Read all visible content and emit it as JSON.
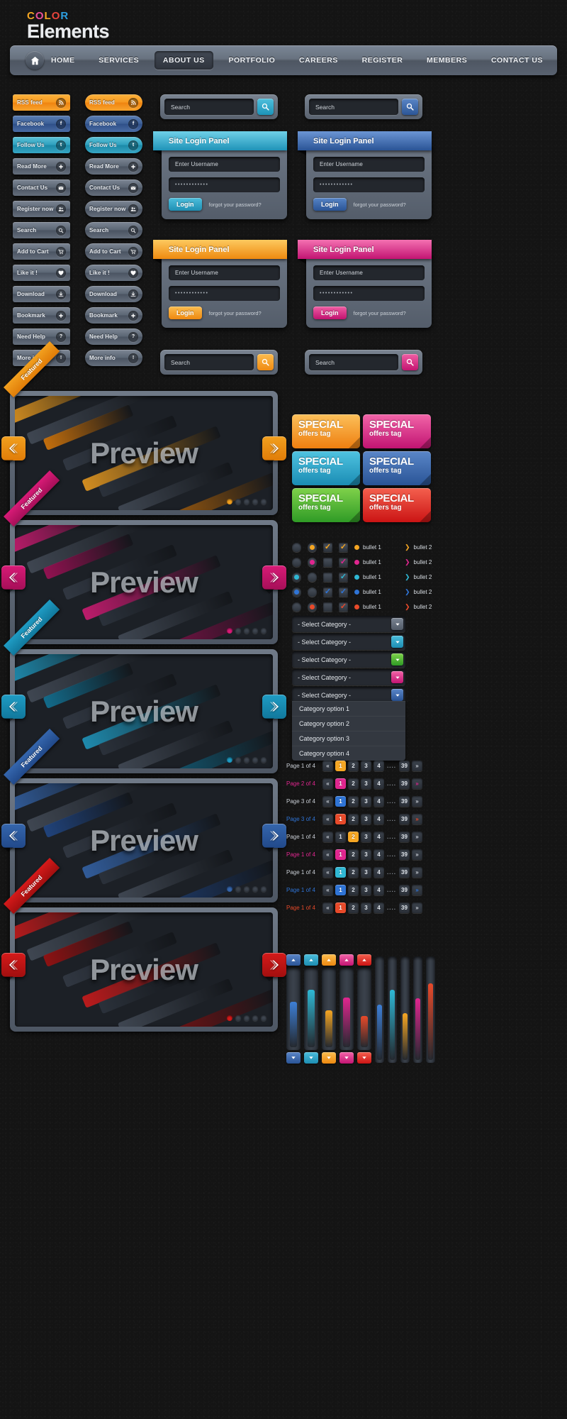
{
  "brand": {
    "color_word": [
      "C",
      "O",
      "L",
      "O",
      "R"
    ],
    "name": "Elements"
  },
  "nav": {
    "home_icon": "home-icon",
    "items": [
      {
        "label": "HOME",
        "active": false
      },
      {
        "label": "SERVICES",
        "active": false
      },
      {
        "label": "ABOUT US",
        "active": true
      },
      {
        "label": "PORTFOLIO",
        "active": false
      },
      {
        "label": "CAREERS",
        "active": false
      },
      {
        "label": "REGISTER",
        "active": false
      },
      {
        "label": "MEMBERS",
        "active": false
      },
      {
        "label": "CONTACT US",
        "active": false
      }
    ]
  },
  "buttons": [
    {
      "label": "RSS feed",
      "icon": "rss-icon",
      "color": "b-orange"
    },
    {
      "label": "Facebook",
      "icon": "facebook-icon",
      "color": "b-blue"
    },
    {
      "label": "Follow Us",
      "icon": "twitter-icon",
      "color": "b-cyan"
    },
    {
      "label": "Read More",
      "icon": "plus-icon",
      "color": "b-grey"
    },
    {
      "label": "Contact Us",
      "icon": "envelope-icon",
      "color": "b-grey"
    },
    {
      "label": "Register now",
      "icon": "users-icon",
      "color": "b-grey"
    },
    {
      "label": "Search",
      "icon": "search-icon",
      "color": "b-grey"
    },
    {
      "label": "Add to Cart",
      "icon": "cart-icon",
      "color": "b-grey"
    },
    {
      "label": "Like it !",
      "icon": "heart-icon",
      "color": "b-grey"
    },
    {
      "label": "Download",
      "icon": "download-icon",
      "color": "b-grey"
    },
    {
      "label": "Bookmark",
      "icon": "star-icon",
      "color": "b-grey"
    },
    {
      "label": "Need Help",
      "icon": "question-icon",
      "color": "b-grey"
    },
    {
      "label": "More info",
      "icon": "info-icon",
      "color": "b-grey"
    }
  ],
  "searchbars": [
    {
      "placeholder": "Search",
      "accent": "s-cyan",
      "icon": "search-icon"
    },
    {
      "placeholder": "Search",
      "accent": "s-blue",
      "icon": "search-icon"
    },
    {
      "placeholder": "Search",
      "accent": "s-orange",
      "icon": "search-icon"
    },
    {
      "placeholder": "Search",
      "accent": "s-pink",
      "icon": "search-icon"
    }
  ],
  "login_panels": [
    {
      "title": "Site Login Panel",
      "username": "Enter Username",
      "password": "••••••••••••",
      "login": "Login",
      "forgot": "forgot your password?",
      "accent": "cyan"
    },
    {
      "title": "Site Login Panel",
      "username": "Enter Username",
      "password": "••••••••••••",
      "login": "Login",
      "forgot": "forgot your password?",
      "accent": "blue"
    },
    {
      "title": "Site Login Panel",
      "username": "Enter Username",
      "password": "••••••••••••",
      "login": "Login",
      "forgot": "forgot your password?",
      "accent": "orange"
    },
    {
      "title": "Site Login Panel",
      "username": "Enter Username",
      "password": "••••••••••••",
      "login": "Login",
      "forgot": "forgot your password?",
      "accent": "pink"
    }
  ],
  "previews": [
    {
      "word": "Preview",
      "ribbon": "Featured",
      "accent": "#f2a01f",
      "accent2": "#e07c08",
      "dots": 5,
      "active": 0
    },
    {
      "word": "Preview",
      "ribbon": "Featured",
      "accent": "#d81b77",
      "accent2": "#a60f58",
      "dots": 5,
      "active": 0
    },
    {
      "word": "Preview",
      "ribbon": "Featured",
      "accent": "#1f9cc4",
      "accent2": "#11789c",
      "dots": 5,
      "active": 0
    },
    {
      "word": "Preview",
      "ribbon": "Featured",
      "accent": "#3566ad",
      "accent2": "#21498a",
      "dots": 5,
      "active": 0
    },
    {
      "word": "Preview",
      "ribbon": "Featured",
      "accent": "#d51a1a",
      "accent2": "#a20f0f",
      "dots": 5,
      "active": 0
    }
  ],
  "tags": [
    {
      "line1": "SPECIAL",
      "line2": "offers tag",
      "color": "t-orange"
    },
    {
      "line1": "SPECIAL",
      "line2": "offers tag",
      "color": "t-pink"
    },
    {
      "line1": "SPECIAL",
      "line2": "offers tag",
      "color": "t-cyan"
    },
    {
      "line1": "SPECIAL",
      "line2": "offers tag",
      "color": "t-blue"
    },
    {
      "line1": "SPECIAL",
      "line2": "offers tag",
      "color": "t-green"
    },
    {
      "line1": "SPECIAL",
      "line2": "offers tag",
      "color": "t-red"
    }
  ],
  "bullets": {
    "rows": [
      {
        "radio_off": "",
        "radio_on": "#f5a623",
        "check_on": true,
        "check_color": "#f5a623",
        "check2_color": "#f5a623",
        "b1": "bullet 1",
        "b1_color": "#f5a623",
        "b2": "bullet 2",
        "b2_color": "#f5a623"
      },
      {
        "radio_off": "",
        "radio_on": "#e0268f",
        "check_on": false,
        "check_color": "#e0268f",
        "check2_color": "#e0268f",
        "b1": "bullet 1",
        "b1_color": "#e0268f",
        "b2": "bullet 2",
        "b2_color": "#e0268f"
      },
      {
        "radio_off": "#2fb8d4",
        "radio_on": "",
        "check_on": false,
        "check_color": "#2fb8d4",
        "check2_color": "#2fb8d4",
        "b1": "bullet 1",
        "b1_color": "#2fb8d4",
        "b2": "bullet 2",
        "b2_color": "#2fb8d4"
      },
      {
        "radio_off": "#2f74d6",
        "radio_on": "",
        "check_on": true,
        "check_color": "#2f74d6",
        "check2_color": "#2f74d6",
        "b1": "bullet 1",
        "b1_color": "#2f74d6",
        "b2": "bullet 2",
        "b2_color": "#2f74d6"
      },
      {
        "radio_off": "",
        "radio_on": "#e84a2a",
        "check_on": false,
        "check_color": "#e84a2a",
        "check2_color": "#e84a2a",
        "b1": "bullet 1",
        "b1_color": "#e84a2a",
        "b2": "bullet 2",
        "b2_color": "#e84a2a"
      }
    ]
  },
  "selects": [
    {
      "value": "- Select Category -",
      "accent": "a-grey"
    },
    {
      "value": "- Select Category -",
      "accent": "a-cyan"
    },
    {
      "value": "- Select Category -",
      "accent": "a-green"
    },
    {
      "value": "- Select Category -",
      "accent": "a-pink"
    },
    {
      "value": "- Select Category -",
      "accent": "a-blue"
    }
  ],
  "dropdown_options": [
    "Category option 1",
    "Category option 2",
    "Category option 3",
    "Category option 4"
  ],
  "pagination": [
    {
      "label": "Page 1 of 4",
      "prev": "«",
      "next": "»",
      "pages": [
        "1",
        "2",
        "3",
        "4",
        "....",
        "39"
      ],
      "active": "1",
      "accent": "#f5a623",
      "label_color": "#c9ced5",
      "prev_color": "#c9ced5",
      "next_color": "#c9ced5"
    },
    {
      "label": "Page 2 of 4",
      "prev": "«",
      "next": "»",
      "pages": [
        "1",
        "2",
        "3",
        "4",
        "....",
        "39"
      ],
      "active": "1",
      "accent": "#e0268f",
      "label_color": "#e0268f",
      "prev_color": "#c9ced5",
      "next_color": "#e0268f"
    },
    {
      "label": "Page 3 of 4",
      "prev": "«",
      "next": "»",
      "pages": [
        "1",
        "2",
        "3",
        "4",
        "....",
        "39"
      ],
      "active": "1",
      "accent": "#2f74d6",
      "label_color": "#c9ced5",
      "prev_color": "#c9ced5",
      "next_color": "#c9ced5"
    },
    {
      "label": "Page 3 of 4",
      "prev": "«",
      "next": "»",
      "pages": [
        "1",
        "2",
        "3",
        "4",
        "....",
        "39"
      ],
      "active": "1",
      "accent": "#e84a2a",
      "label_color": "#2f74d6",
      "prev_color": "#c9ced5",
      "next_color": "#e84a2a"
    },
    {
      "label": "Page 1 of 4",
      "prev": "«",
      "next": "»",
      "pages": [
        "1",
        "2",
        "3",
        "4",
        "....",
        "39"
      ],
      "active": "2",
      "accent": "#f5a623",
      "label_color": "#c9ced5",
      "prev_color": "#c9ced5",
      "next_color": "#c9ced5"
    },
    {
      "label": "Page 1 of 4",
      "prev": "«",
      "next": "»",
      "pages": [
        "1",
        "2",
        "3",
        "4",
        "....",
        "39"
      ],
      "active": "1",
      "accent": "#e0268f",
      "label_color": "#e0268f",
      "prev_color": "#c9ced5",
      "next_color": "#c9ced5"
    },
    {
      "label": "Page 1 of 4",
      "prev": "«",
      "next": "»",
      "pages": [
        "1",
        "2",
        "3",
        "4",
        "....",
        "39"
      ],
      "active": "1",
      "accent": "#2fb8d4",
      "label_color": "#c9ced5",
      "prev_color": "#c9ced5",
      "next_color": "#c9ced5"
    },
    {
      "label": "Page 1 of 4",
      "prev": "«",
      "next": "»",
      "pages": [
        "1",
        "2",
        "3",
        "4",
        "....",
        "39"
      ],
      "active": "1",
      "accent": "#2f74d6",
      "label_color": "#2f74d6",
      "prev_color": "#c9ced5",
      "next_color": "#2f74d6"
    },
    {
      "label": "Page 1 of 4",
      "prev": "«",
      "next": "»",
      "pages": [
        "1",
        "2",
        "3",
        "4",
        "....",
        "39"
      ],
      "active": "1",
      "accent": "#e84a2a",
      "label_color": "#e84a2a",
      "prev_color": "#c9ced5",
      "next_color": "#c9ced5"
    }
  ],
  "sliders": [
    {
      "color": "#3d7fd6",
      "value": 55,
      "cap": "a-blue",
      "icon": "chevron-up-icon"
    },
    {
      "color": "#2fb8d4",
      "value": 70,
      "cap": "a-cyan",
      "icon": "chevron-up-icon"
    },
    {
      "color": "#f5a623",
      "value": 45,
      "cap": "a-orange",
      "icon": "chevron-up-icon"
    },
    {
      "color": "#e0268f",
      "value": 60,
      "cap": "a-pink",
      "icon": "chevron-up-icon"
    },
    {
      "color": "#e84a2a",
      "value": 38,
      "cap": "a-red",
      "icon": "chevron-up-icon"
    },
    {
      "color": "#3d7fd6",
      "value": 52,
      "cap": "",
      "icon": ""
    },
    {
      "color": "#2fb8d4",
      "value": 66,
      "cap": "",
      "icon": ""
    },
    {
      "color": "#f5a623",
      "value": 44,
      "cap": "",
      "icon": ""
    },
    {
      "color": "#e0268f",
      "value": 58,
      "cap": "",
      "icon": ""
    },
    {
      "color": "#e84a2a",
      "value": 72,
      "cap": "",
      "icon": ""
    }
  ]
}
